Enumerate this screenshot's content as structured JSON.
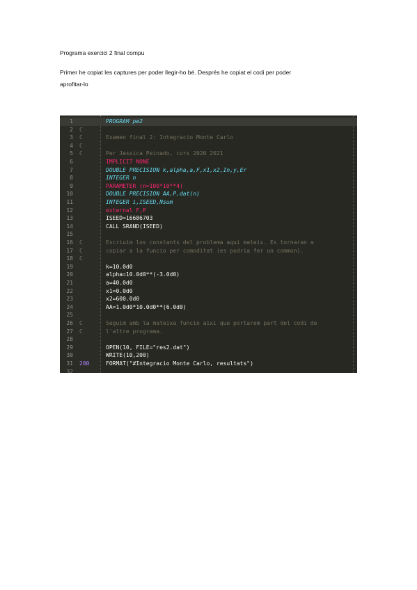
{
  "document": {
    "title": "Programa exercici 2 final compu",
    "paragraph_lines": [
      "Primer he copiat les captures per poder llegir-ho bé. Després he copiat el codi per poder",
      "aprofitar-lo"
    ]
  },
  "editor": {
    "lines": [
      {
        "n": "1",
        "label": "",
        "code": "PROGRAM pe2",
        "color": "#66d9ef",
        "italic": true
      },
      {
        "n": "2",
        "label": "C",
        "code": "",
        "color": "#75715e",
        "italic": false
      },
      {
        "n": "3",
        "label": "C",
        "code": "Examen final 2: Integracio Monte Carlo",
        "color": "#75715e",
        "italic": false
      },
      {
        "n": "4",
        "label": "C",
        "code": "",
        "color": "#75715e",
        "italic": false
      },
      {
        "n": "5",
        "label": "C",
        "code": "Per Jessica Peinado, curs 2020 2021",
        "color": "#75715e",
        "italic": false
      },
      {
        "n": "6",
        "label": "",
        "code": "IMPLICIT NONE",
        "color": "#f92672",
        "italic": false
      },
      {
        "n": "7",
        "label": "",
        "code": "DOUBLE PRECISION k,alpha,a,F,x1,x2,In,y,Er",
        "color": "#66d9ef",
        "italic": true
      },
      {
        "n": "8",
        "label": "",
        "code": "INTEGER n",
        "color": "#66d9ef",
        "italic": true
      },
      {
        "n": "9",
        "label": "",
        "code": "PARAMETER (n=100*10**4)",
        "color": "#f92672",
        "italic": false
      },
      {
        "n": "10",
        "label": "",
        "code": "DOUBLE PRECISION AA,P,dat(n)",
        "color": "#66d9ef",
        "italic": true
      },
      {
        "n": "11",
        "label": "",
        "code": "INTEGER i,ISEED,Nsum",
        "color": "#66d9ef",
        "italic": true
      },
      {
        "n": "12",
        "label": "",
        "code": "external F,P",
        "color": "#f92672",
        "italic": false
      },
      {
        "n": "13",
        "label": "",
        "code": "ISEED=16686703",
        "color": "#f8f8f2",
        "italic": false
      },
      {
        "n": "14",
        "label": "",
        "code": "CALL SRAND(ISEED)",
        "color": "#f8f8f2",
        "italic": false
      },
      {
        "n": "15",
        "label": "",
        "code": "",
        "color": "#f8f8f2",
        "italic": false
      },
      {
        "n": "16",
        "label": "C",
        "code": "Escriuim los constants del problema aqui mateix. Es tornaran a",
        "color": "#75715e",
        "italic": false
      },
      {
        "n": "17",
        "label": "C",
        "code": "copiar a la funcio per comoditat (es podria fer un common).",
        "color": "#75715e",
        "italic": false
      },
      {
        "n": "18",
        "label": "C",
        "code": "",
        "color": "#75715e",
        "italic": false
      },
      {
        "n": "19",
        "label": "",
        "code": "k=10.0d0",
        "color": "#f8f8f2",
        "italic": false
      },
      {
        "n": "20",
        "label": "",
        "code": "alpha=10.0d0**(-3.0d0)",
        "color": "#f8f8f2",
        "italic": false
      },
      {
        "n": "21",
        "label": "",
        "code": "a=40.0d0",
        "color": "#f8f8f2",
        "italic": false
      },
      {
        "n": "22",
        "label": "",
        "code": "x1=0.0d0",
        "color": "#f8f8f2",
        "italic": false
      },
      {
        "n": "23",
        "label": "",
        "code": "x2=600.0d0",
        "color": "#f8f8f2",
        "italic": false
      },
      {
        "n": "24",
        "label": "",
        "code": "AA=1.0d0*10.0d0**(6.0d0)",
        "color": "#f8f8f2",
        "italic": false
      },
      {
        "n": "25",
        "label": "",
        "code": "",
        "color": "#f8f8f2",
        "italic": false
      },
      {
        "n": "26",
        "label": "C",
        "code": "Seguim amb la mateixa funcio aixi que portarem part del codi de",
        "color": "#75715e",
        "italic": false
      },
      {
        "n": "27",
        "label": "C",
        "code": "l'altre programa.",
        "color": "#75715e",
        "italic": false
      },
      {
        "n": "28",
        "label": "",
        "code": "",
        "color": "#f8f8f2",
        "italic": false
      },
      {
        "n": "29",
        "label": "",
        "code": "OPEN(10, FILE=\"res2.dat\")",
        "color": "#f8f8f2",
        "italic": false
      },
      {
        "n": "30",
        "label": "",
        "code": "WRITE(10,200)",
        "color": "#f8f8f2",
        "italic": false
      },
      {
        "n": "31",
        "label": "200",
        "code": "FORMAT(\"#Integracio Monte Carlo, resultats\")",
        "color": "#f8f8f2",
        "italic": false
      },
      {
        "n": "32",
        "label": "",
        "code": "",
        "color": "#f8f8f2",
        "italic": false
      }
    ]
  }
}
